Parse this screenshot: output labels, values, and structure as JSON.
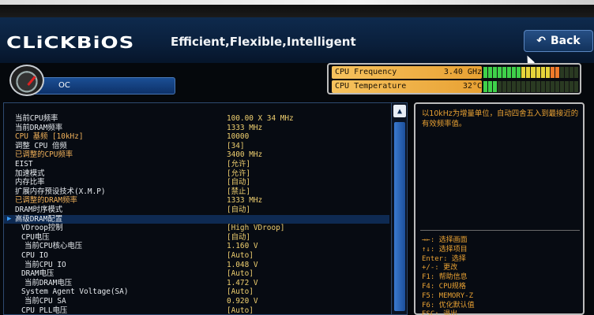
{
  "header": {
    "logo": "CLiCKBiOS",
    "tagline": "Efficient,Flexible,Intelligent",
    "back_label": "Back",
    "back_icon": "back-arrow-icon"
  },
  "oc": {
    "label": "OC",
    "icon": "speedometer-icon"
  },
  "status": {
    "cpu_frequency": {
      "label": "CPU Frequency",
      "value": "3.40 GHz",
      "level": 0.82
    },
    "cpu_temperature": {
      "label": "CPU Temperature",
      "value": "32°C",
      "level": 0.15
    }
  },
  "settings": [
    {
      "name": "当前CPU频率",
      "value": "100.00 X 34 MHz"
    },
    {
      "name": "当前DRAM频率",
      "value": "1333 MHz"
    },
    {
      "name": "CPU 基频 [10kHz]",
      "value": "10000"
    },
    {
      "name": "调整 CPU 倍频",
      "value": "[34]"
    },
    {
      "name": "已调整的CPU频率",
      "value": "3400 MHz"
    },
    {
      "name": "EIST",
      "value": "[允许]"
    },
    {
      "name": "加速模式",
      "value": "[允许]"
    },
    {
      "name": "内存比率",
      "value": "[自动]"
    },
    {
      "name": "扩展内存预设技术(X.M.P)",
      "value": "[禁止]"
    },
    {
      "name": "已调整的DRAM频率",
      "value": "1333 MHz"
    },
    {
      "name": "DRAM时序模式",
      "value": "[自动]"
    },
    {
      "name": "高级DRAM配置",
      "value": ""
    },
    {
      "name": "VDroop控制",
      "value": "[High VDroop]"
    },
    {
      "name": "CPU电压",
      "value": "[自动]"
    },
    {
      "name": "当前CPU核心电压",
      "value": "1.160 V"
    },
    {
      "name": "CPU IO",
      "value": "[Auto]"
    },
    {
      "name": "当前CPU IO",
      "value": "1.048 V"
    },
    {
      "name": "DRAM电压",
      "value": "[Auto]"
    },
    {
      "name": "当前DRAM电压",
      "value": "1.472 V"
    },
    {
      "name": "System Agent Voltage(SA)",
      "value": "[Auto]"
    },
    {
      "name": "当前CPU SA",
      "value": "0.920 V"
    },
    {
      "name": "CPU PLL电压",
      "value": "[Auto]"
    }
  ],
  "help": {
    "text": "以10kHz为增量单位，自动四舍五入到最接近的有效频率值。",
    "keys": [
      "→←: 选择画面",
      "↑↓: 选择项目",
      "Enter: 选择",
      "+/-: 更改",
      "F1: 帮助信息",
      "F4: CPU规格",
      "F5: MEMORY-Z",
      "F6: 优化默认值",
      "ESC: 退出"
    ]
  },
  "colors": {
    "accent": "#e8a133",
    "value": "#f0d070",
    "panel_border": "#bcbcbc"
  }
}
